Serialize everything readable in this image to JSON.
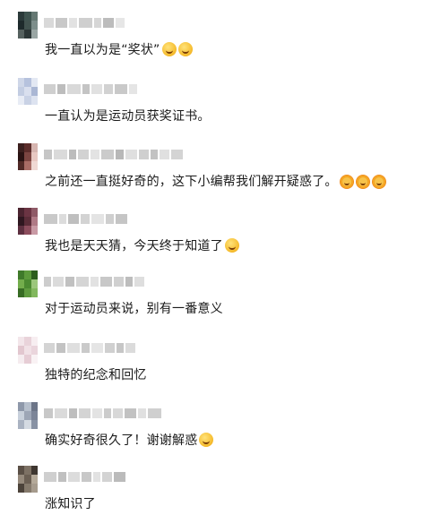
{
  "comments": [
    {
      "text": "我一直以为是“奖状”",
      "emoji": [
        "laughing-crying-icon",
        "laughing-crying-icon"
      ],
      "avatar": [
        "#2b3a3a",
        "#3f5450",
        "#657873",
        "#1e2a2c",
        "#41524f",
        "#7d8e8b",
        "#56615f",
        "#2d3737",
        "#9aa6a4"
      ],
      "name_bar": [
        "#d9d9d9",
        "#c8c8c8",
        "#e2e2e2",
        "#cfcfcf",
        "#d6d6d6",
        "#bcbcbc",
        "#e6e6e6"
      ]
    },
    {
      "text": "一直认为是运动员获奖证书。",
      "emoji": [],
      "avatar": [
        "#cfd7e8",
        "#b6c2dd",
        "#e3e8f3",
        "#c3cde2",
        "#d9dfee",
        "#aab7d4",
        "#e8ecf5",
        "#c9d2e5",
        "#dde3f0"
      ],
      "name_bar": [
        "#cfcfcf",
        "#bdbdbd",
        "#d9d9d9",
        "#c4c4c4",
        "#e1e1e1",
        "#d2d2d2",
        "#c9c9c9",
        "#e5e5e5"
      ]
    },
    {
      "text": "之前还一直挺好奇的，这下小编帮我们解开疑惑了。",
      "emoji": [
        "sun-icon",
        "sun-icon",
        "sun-icon"
      ],
      "avatar": [
        "#3b1f1e",
        "#5b2c2a",
        "#d6b5b0",
        "#2a1313",
        "#7b4541",
        "#e8c8c2",
        "#502a27",
        "#a86c65",
        "#f0d9d4"
      ],
      "name_bar": [
        "#c6c6c6",
        "#dadada",
        "#bcbcbc",
        "#d2d2d2",
        "#e3e3e3",
        "#cbcbcb",
        "#b8b8b8",
        "#dfdfdf",
        "#cfcfcf",
        "#c2c2c2",
        "#e0e0e0",
        "#d4d4d4"
      ]
    },
    {
      "text": "我也是天天猜，今天终于知道了",
      "emoji": [
        "grinning-icon"
      ],
      "avatar": [
        "#4b2430",
        "#6b3443",
        "#8f5a67",
        "#2f1720",
        "#5a2c38",
        "#b07a86",
        "#5d3040",
        "#8c4d5d",
        "#c99aa5"
      ],
      "name_bar": [
        "#c9c9c9",
        "#dcdcdc",
        "#bfbfbf",
        "#d3d3d3",
        "#e4e4e4",
        "#cfcfcf",
        "#c5c5c5"
      ]
    },
    {
      "text": "对于运动员来说，别有一番意义",
      "emoji": [],
      "avatar": [
        "#3f7a2a",
        "#5c9a3b",
        "#2c5e1d",
        "#73ad4c",
        "#4b8a31",
        "#9cc77c",
        "#386c24",
        "#5f9b3f",
        "#82b85e"
      ],
      "name_bar": [
        "#cdcdcd",
        "#dbdbdb",
        "#c1c1c1",
        "#d5d5d5",
        "#e2e2e2",
        "#c8c8c8",
        "#d0d0d0",
        "#bdbdbd",
        "#dedede"
      ]
    },
    {
      "text": "独特的纪念和回忆",
      "emoji": [],
      "avatar": [
        "#f3e6ea",
        "#e9d3da",
        "#f7eef1",
        "#e2c7cf",
        "#f1e1e6",
        "#ead5dc",
        "#f5ecef",
        "#e6cdd5",
        "#f9f2f4"
      ],
      "name_bar": [
        "#d4d4d4",
        "#c3c3c3",
        "#dfdfdf",
        "#cacaca",
        "#e5e5e5",
        "#d0d0d0",
        "#c6c6c6",
        "#dbdbdb"
      ]
    },
    {
      "text": "确实好奇很久了！谢谢解惑",
      "emoji": [
        "thinking-icon"
      ],
      "avatar": [
        "#8e98aa",
        "#b6bfcc",
        "#6c7588",
        "#c8d0db",
        "#9da6b6",
        "#7c8598",
        "#aab3c2",
        "#d4dae2",
        "#8892a4"
      ],
      "name_bar": [
        "#c8c8c8",
        "#dadada",
        "#bebebe",
        "#d4d4d4",
        "#e3e3e3",
        "#cccccc",
        "#d8d8d8",
        "#c2c2c2",
        "#e0e0e0",
        "#cfcfcf"
      ]
    },
    {
      "text": "涨知识了",
      "emoji": [],
      "avatar": [
        "#5a4f45",
        "#7d7164",
        "#3e3630",
        "#968a7c",
        "#6b5f53",
        "#b4a999",
        "#4c433a",
        "#857a6c",
        "#a69b8d"
      ],
      "name_bar": [
        "#cfcfcf",
        "#c0c0c0",
        "#dcdcdc",
        "#c8c8c8",
        "#e2e2e2",
        "#d3d3d3",
        "#bbbbbb"
      ]
    }
  ]
}
